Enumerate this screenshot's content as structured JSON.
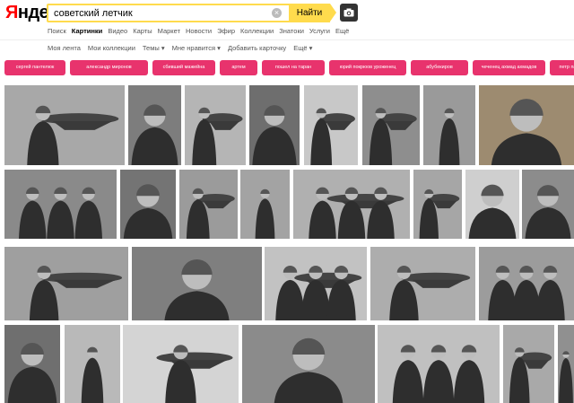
{
  "header": {
    "logo_first": "Я",
    "logo_rest": "ндекс",
    "search_value": "советский летчик",
    "search_button": "Найти"
  },
  "services": [
    {
      "label": "Поиск",
      "active": false
    },
    {
      "label": "Картинки",
      "active": true
    },
    {
      "label": "Видео",
      "active": false
    },
    {
      "label": "Карты",
      "active": false
    },
    {
      "label": "Маркет",
      "active": false
    },
    {
      "label": "Новости",
      "active": false
    },
    {
      "label": "Эфир",
      "active": false
    },
    {
      "label": "Коллекции",
      "active": false
    },
    {
      "label": "Знатоки",
      "active": false
    },
    {
      "label": "Услуги",
      "active": false
    },
    {
      "label": "Ещё",
      "active": false
    }
  ],
  "subnav": [
    {
      "label": "Моя лента"
    },
    {
      "label": "Мои коллекции"
    },
    {
      "label": "Темы ▾"
    },
    {
      "label": "Мне нравится ▾"
    },
    {
      "label": "Добавить карточку"
    },
    {
      "label": "Ещё ▾"
    }
  ],
  "chips": [
    "сергей пантелюк",
    "александр миронов",
    "сбивший мажейна",
    "артем",
    "пошел на таран",
    "юрий покрюов уроженец",
    "абубекиров",
    "чеченец ахмад ахмадов",
    "петр павл"
  ],
  "colors": {
    "accent_yellow": "#ffdb4d",
    "chip_pink": "#e8336d",
    "logo_red": "#ff0000"
  },
  "icons": {
    "clear": "×",
    "camera": "camera-icon"
  },
  "tiles": [
    {
      "tone": "#a8a8a8",
      "subject": "pilot-with-plane"
    },
    {
      "tone": "#7d7d7d",
      "subject": "pilot-portrait"
    },
    {
      "tone": "#b5b5b5",
      "subject": "pilot-standing-plane"
    },
    {
      "tone": "#6e6e6e",
      "subject": "pilot-portrait"
    },
    {
      "tone": "#c8c8c8",
      "subject": "pilot-standing-plane"
    },
    {
      "tone": "#8e8e8e",
      "subject": "pilot-standing-plane"
    },
    {
      "tone": "#9a9a9a",
      "subject": "pilot-standing"
    },
    {
      "tone": "#9d8b70",
      "subject": "pilot-closeup"
    },
    {
      "tone": "#8a8a8a",
      "subject": "pilot-group"
    },
    {
      "tone": "#747474",
      "subject": "pilot-portrait"
    },
    {
      "tone": "#9b9b9b",
      "subject": "pilot-on-plane"
    },
    {
      "tone": "#a3a3a3",
      "subject": "pilot-standing"
    },
    {
      "tone": "#b0b0b0",
      "subject": "pilot-group-plane"
    },
    {
      "tone": "#a6a6a6",
      "subject": "pilot-with-plane"
    },
    {
      "tone": "#cfcfcf",
      "subject": "pilot-portrait"
    },
    {
      "tone": "#8c8c8c",
      "subject": "pilot-portrait"
    },
    {
      "tone": "#9f9f9f",
      "subject": "pilot-with-plane"
    },
    {
      "tone": "#7f7f7f",
      "subject": "pilots-closeup"
    },
    {
      "tone": "#c2c2c2",
      "subject": "pilot-group-plane"
    },
    {
      "tone": "#adadad",
      "subject": "pilot-with-plane"
    },
    {
      "tone": "#9c9c9c",
      "subject": "pilot-group"
    },
    {
      "tone": "#6f6f6f",
      "subject": "pilot-portrait"
    },
    {
      "tone": "#b9b9b9",
      "subject": "pilot-document"
    },
    {
      "tone": "#d4d4d4",
      "subject": "pilot-in-cockpit"
    },
    {
      "tone": "#8b8b8b",
      "subject": "pilot-closeup"
    },
    {
      "tone": "#c0c0c0",
      "subject": "pilot-group"
    },
    {
      "tone": "#a9a9a9",
      "subject": "pilot-with-plane"
    },
    {
      "tone": "#909090",
      "subject": "pilot-portrait"
    },
    {
      "tone": "#6a6a6a",
      "subject": "pilot-standing"
    }
  ]
}
